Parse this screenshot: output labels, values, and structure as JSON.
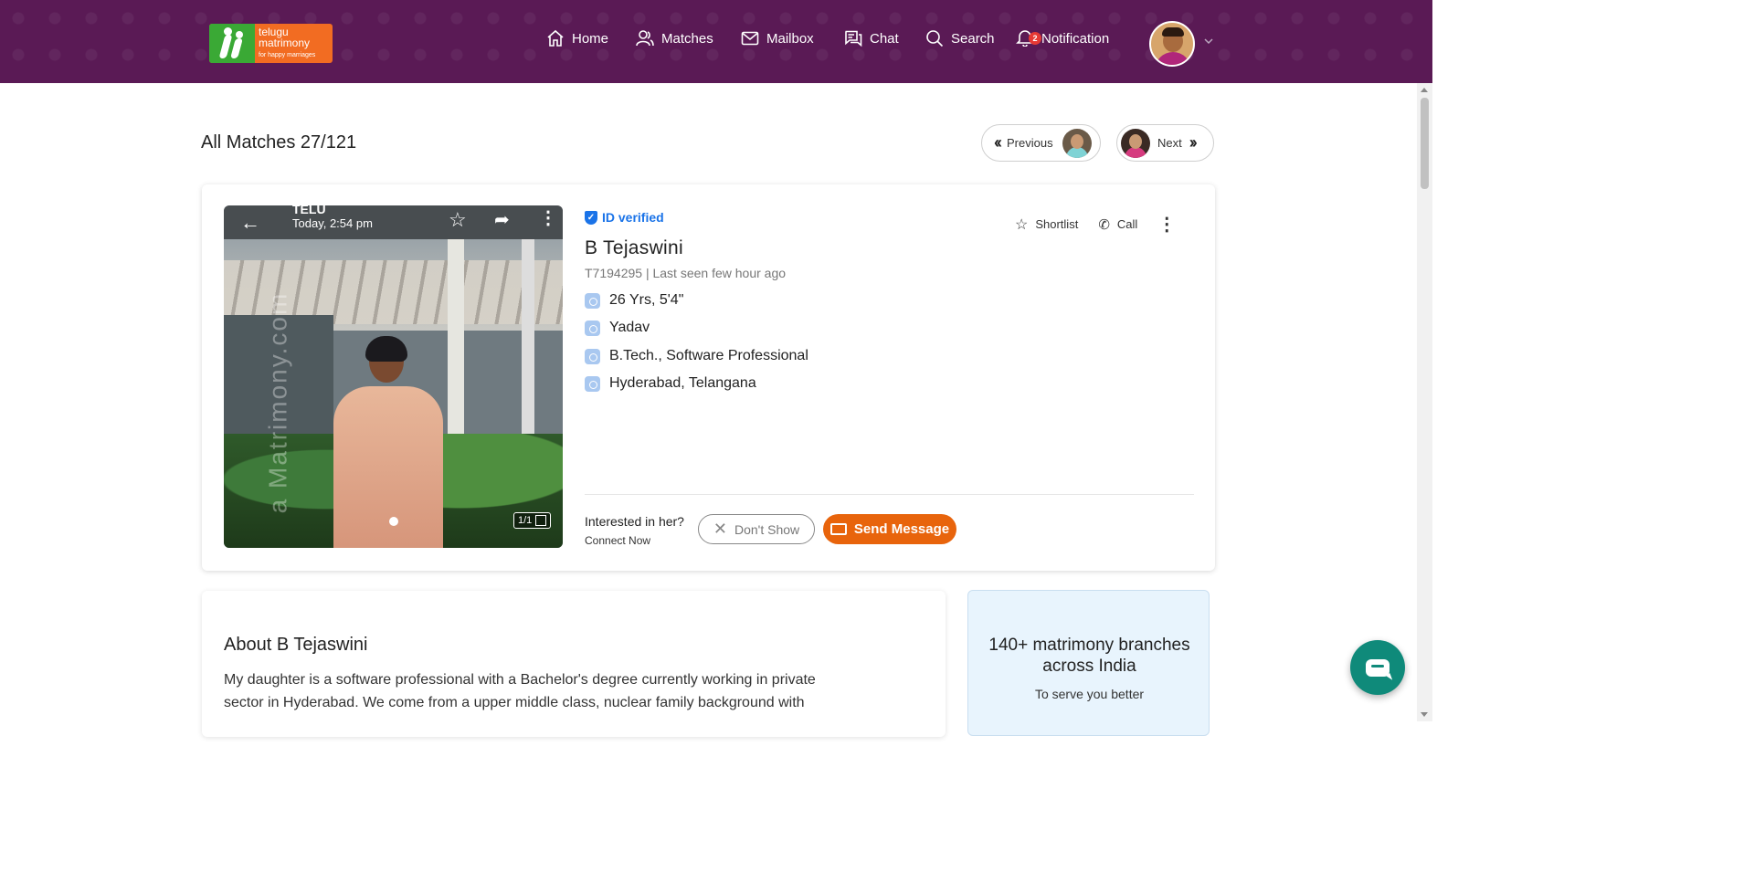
{
  "header": {
    "logo": {
      "line1": "telugu",
      "line2": "matrimony",
      "tagline": "for happy marriages"
    },
    "nav": [
      {
        "label": "Home",
        "icon": "home-icon"
      },
      {
        "label": "Matches",
        "icon": "users-icon"
      },
      {
        "label": "Mailbox",
        "icon": "mail-icon"
      },
      {
        "label": "Chat",
        "icon": "chat-icon"
      },
      {
        "label": "Search",
        "icon": "search-icon"
      },
      {
        "label": "Notification",
        "icon": "bell-icon",
        "badge": "2"
      }
    ],
    "colors": {
      "bar": "#5a1a55",
      "logo_orange": "#f26c22",
      "logo_green": "#3aa935"
    }
  },
  "page": {
    "title": "All Matches 27/121",
    "previous_label": "Previous",
    "next_label": "Next"
  },
  "profile": {
    "verified_label": "ID verified",
    "name": "B Tejaswini",
    "id_line": "T7194295 | Last seen few hour ago",
    "attributes": [
      {
        "icon": "age-height-icon",
        "value": "26 Yrs, 5'4\""
      },
      {
        "icon": "community-icon",
        "value": "Yadav"
      },
      {
        "icon": "education-icon",
        "value": "B.Tech., Software Professional"
      },
      {
        "icon": "location-icon",
        "value": "Hyderabad, Telangana"
      }
    ],
    "actions": {
      "shortlist": "Shortlist",
      "call": "Call"
    },
    "photo": {
      "title": "TELU",
      "time": "Today, 2:54 pm",
      "watermark": "a Matrimony.com",
      "counter": "1/1"
    },
    "interest_question": "Interested in her?",
    "connect_now": "Connect Now",
    "dont_show": "Don't Show",
    "send_message": "Send Message",
    "colors": {
      "accent": "#e8640c",
      "verified": "#1a73e8"
    }
  },
  "about": {
    "title": "About B Tejaswini",
    "text": "My daughter is a software professional with a Bachelor's degree currently working in private sector in Hyderabad. We come from a upper middle class, nuclear family background with"
  },
  "promo": {
    "title": "140+ matrimony branches across India",
    "subtitle": "To serve you better"
  }
}
